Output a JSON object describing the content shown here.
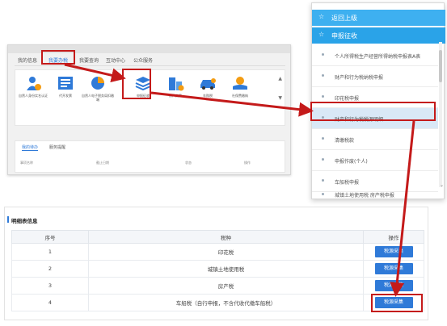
{
  "portal": {
    "tabs": [
      "我的信息",
      "我要办税",
      "我要查询",
      "互动中心",
      "公众服务"
    ],
    "active_tab": 1,
    "services": [
      {
        "label": "自然人身份实名认证",
        "icon": "person-icon",
        "color": "#2f7ad8"
      },
      {
        "label": "代开发票",
        "icon": "invoice-icon",
        "color": "#2f7ad8"
      },
      {
        "label": "自然人电子税务局扣缴端",
        "icon": "tax-client-icon",
        "color": "#f39c12"
      },
      {
        "label": "申报征收",
        "icon": "stack-icon",
        "color": "#2f7ad8"
      },
      {
        "label": "房产交易",
        "icon": "building-icon",
        "color": "#2f7ad8"
      },
      {
        "label": "车购税",
        "icon": "car-icon",
        "color": "#2f7ad8"
      },
      {
        "label": "社保费缴纳",
        "icon": "hand-icon",
        "color": "#f39c12"
      }
    ],
    "lower_tabs": [
      "我的待办",
      "服务提醒"
    ],
    "lower_columns": [
      "事项名称",
      "截止日期",
      "状态",
      "操作"
    ]
  },
  "menu": {
    "back_label": "返回上级",
    "section_label": "申报征收",
    "items": [
      "个人所得税生产经营所得纳税申报表A表",
      "财产和行为税纳税申报",
      "印花税申报",
      "财产和行为税税源明细",
      "清缴税款",
      "申报作废(个人)",
      "车船税申报",
      "城镇土地使用税 房产税申报"
    ],
    "active_index": 3
  },
  "detail": {
    "title": "明细表信息",
    "columns": [
      "序号",
      "税种",
      "操作"
    ],
    "rows": [
      {
        "no": "1",
        "tax": "印花税",
        "action": "税源采集"
      },
      {
        "no": "2",
        "tax": "城镇土地使用税",
        "action": "税源采集"
      },
      {
        "no": "3",
        "tax": "房产税",
        "action": "税源采集"
      },
      {
        "no": "4",
        "tax": "车船税（自行申报，不含代收代缴车船税）",
        "action": "税源采集"
      }
    ]
  },
  "colors": {
    "accent": "#2f7ad8",
    "menu_header": "#3eb0f0",
    "highlight": "#c41a1a"
  }
}
